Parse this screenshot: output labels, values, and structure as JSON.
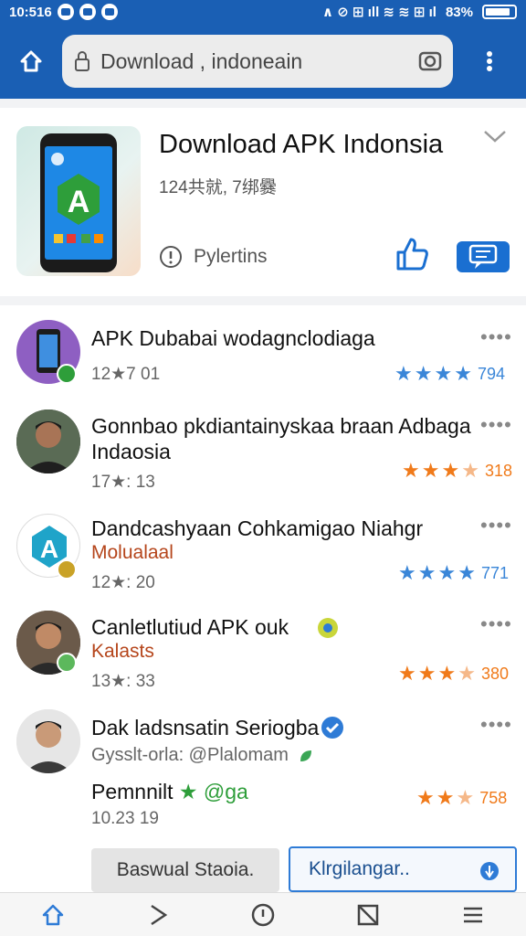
{
  "status_bar": {
    "time": "10:516",
    "battery": "83%"
  },
  "browser": {
    "url": "Download , indoneain"
  },
  "hero": {
    "title": "Download APK Indonsia",
    "subtitle": "124共就, 7绑爨",
    "info_label": "Pylertins"
  },
  "items": [
    {
      "title": "APK Dubabai wodagnclodiaga",
      "meta": "12★7 01",
      "rating_value": "794",
      "stars": 4
    },
    {
      "title": "Gonnbao pkdiantainyskaa braan Adbaga",
      "title_line2": "Indaosia",
      "meta": "17★: 13",
      "rating_value": "318",
      "stars": 3
    },
    {
      "title": "Dandcashyaan Cohkamigao Niahgr",
      "subtitle": "Molualaal",
      "meta": "12★: 20",
      "rating_value": "771",
      "stars": 4
    },
    {
      "title": "Canletlutiud APK ouk",
      "subtitle": "Kalasts",
      "meta": "13★: 33",
      "rating_value": "380",
      "stars": 3
    },
    {
      "title": "Dak ladsnsatin Seriogba",
      "subtitle": "Gysslt-orla: @Plalomam",
      "meta_title": "Pemnnilt",
      "meta_title_suffix": "@ga",
      "meta": "10.23 19",
      "rating_value": "758",
      "stars": 2
    }
  ],
  "actions": {
    "primary_label": "Baswual Staoia.",
    "secondary_label": "Klrgilangar.."
  },
  "colors": {
    "brand": "#1a5fb4",
    "star_blue": "#3a86d8",
    "star_orange": "#f07a1a"
  }
}
